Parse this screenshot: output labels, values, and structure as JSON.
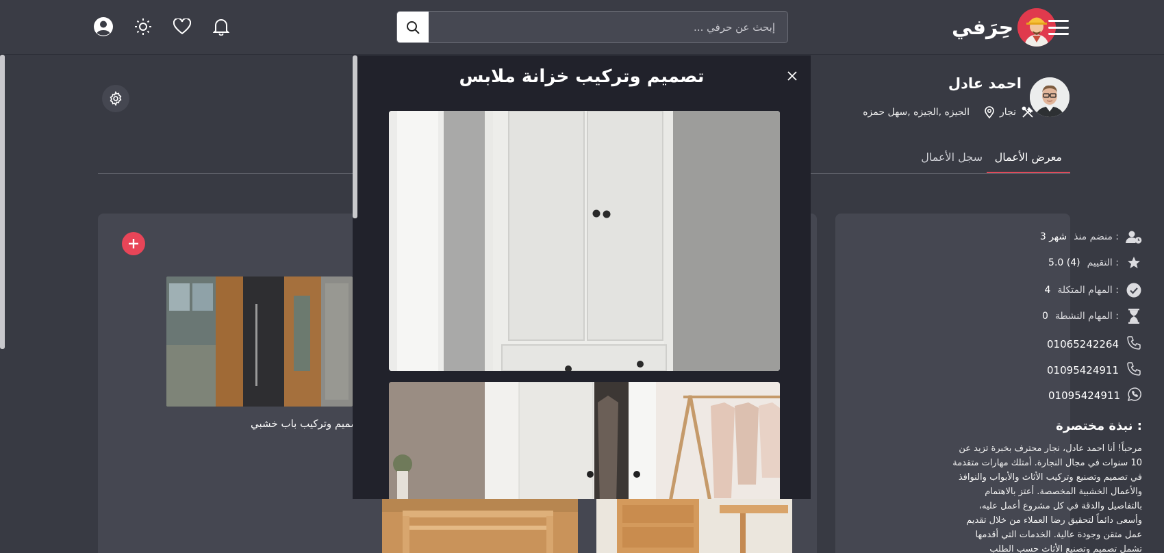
{
  "header": {
    "brand_name": "حِرَفي",
    "search_placeholder": "إبحث عن حرفي ..."
  },
  "icons": {
    "menu": "menu-icon",
    "search": "search-icon",
    "bell": "bell-icon",
    "heart": "heart-icon",
    "theme": "sun-icon",
    "user": "user-icon"
  },
  "profile": {
    "name": "احمد عادل",
    "profession": "نجار",
    "location": "الجيزه ,الجيزه ,سهل حمزه"
  },
  "tabs": [
    {
      "label": "معرض الأعمال",
      "active": true
    },
    {
      "label": "سجل الأعمال",
      "active": false
    }
  ],
  "stats": [
    {
      "label": "منضم منذ :",
      "value": "3 شهر",
      "icon": "user-clock-icon"
    },
    {
      "label": "التقييم :",
      "value": "5.0 (4)",
      "icon": "star-icon"
    },
    {
      "label": "المهام المتكلة :",
      "value": "4",
      "icon": "check-circle-icon"
    },
    {
      "label": "المهام النشطة :",
      "value": "0",
      "icon": "hourglass-icon"
    }
  ],
  "contacts": [
    {
      "value": "01065242264",
      "icon": "phone-icon"
    },
    {
      "value": "01095424911",
      "icon": "phone-icon"
    },
    {
      "value": "01095424911",
      "icon": "whatsapp-icon"
    }
  ],
  "bio": {
    "title": "نبذة مختصرة :",
    "text": "مرحباً! أنا احمد عادل، نجار محترف بخبرة تزيد عن 10 سنوات في مجال النجارة. أمتلك مهارات متقدمة في تصميم وتصنيع وتركيب الأثاث والأبواب والنوافذ والأعمال الخشبية المخصصة. أعتز بالاهتمام بالتفاصيل والدقة في كل مشروع أعمل عليه، وأسعى دائماً لتحقيق رضا العملاء من خلال تقديم عمل متقن وجودة عالية. الخدمات التي أقدمها تشمل تصميم وتصنيع الأثاث حسب الطلب"
  },
  "works": [
    {
      "caption": "تصميم وتركيب باب خشبي"
    }
  ],
  "modal": {
    "title": "تصميم وتركيب خزانة ملابس"
  },
  "colors": {
    "accent": "#e84558",
    "background": "#383a43",
    "card": "#454751",
    "modal": "#21222b"
  }
}
